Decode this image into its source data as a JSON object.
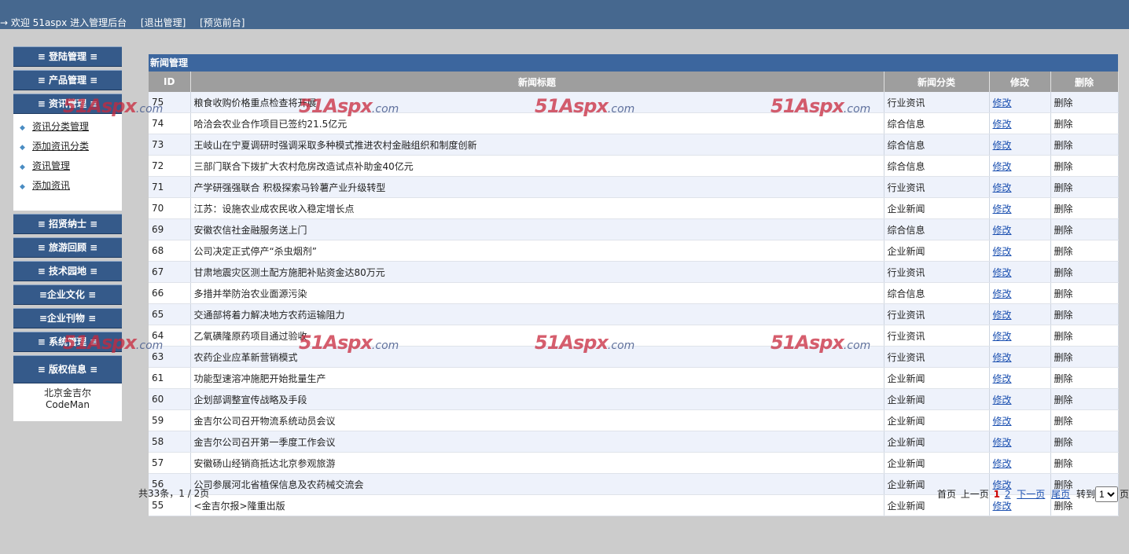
{
  "header": {
    "welcome": "→ 欢迎 51aspx  进入管理后台",
    "logout": "[退出管理]",
    "preview": "[预览前台]"
  },
  "sidebar": {
    "menus": [
      {
        "label": "≡ 登陆管理 ≡"
      },
      {
        "label": "≡ 产品管理 ≡"
      },
      {
        "label": "≡ 资讯管理 ≡"
      },
      {
        "label": "≡ 招贤纳士 ≡"
      },
      {
        "label": "≡ 旅游回顾 ≡"
      },
      {
        "label": "≡ 技术园地 ≡"
      },
      {
        "label": "≡企业文化 ≡"
      },
      {
        "label": "≡企业刊物 ≡"
      },
      {
        "label": "≡ 系统管理 ≡"
      },
      {
        "label": "≡ 版权信息 ≡"
      }
    ],
    "submenu": [
      {
        "label": "资讯分类管理"
      },
      {
        "label": "添加资讯分类"
      },
      {
        "label": "资讯管理"
      },
      {
        "label": "添加资讯"
      }
    ],
    "copyright_line1": "北京金吉尔",
    "copyright_line2": "CodeMan"
  },
  "panel": {
    "title": "新闻管理",
    "columns": [
      "ID",
      "新闻标题",
      "新闻分类",
      "修改",
      "删除"
    ],
    "rows": [
      {
        "id": "75",
        "title": "粮食收购价格重点检查将开展",
        "category": "行业资讯",
        "edit": "修改",
        "del": "删除"
      },
      {
        "id": "74",
        "title": "哈洽会农业合作项目已签约21.5亿元",
        "category": "综合信息",
        "edit": "修改",
        "del": "删除"
      },
      {
        "id": "73",
        "title": "王岐山在宁夏调研时强调采取多种模式推进农村金融组织和制度创新",
        "category": "综合信息",
        "edit": "修改",
        "del": "删除"
      },
      {
        "id": "72",
        "title": "三部门联合下拨扩大农村危房改造试点补助金40亿元",
        "category": "综合信息",
        "edit": "修改",
        "del": "删除"
      },
      {
        "id": "71",
        "title": "产学研强强联合 积极探索马铃薯产业升级转型",
        "category": "行业资讯",
        "edit": "修改",
        "del": "删除"
      },
      {
        "id": "70",
        "title": "江苏：设施农业成农民收入稳定增长点",
        "category": "企业新闻",
        "edit": "修改",
        "del": "删除"
      },
      {
        "id": "69",
        "title": "安徽农信社金融服务送上门",
        "category": "综合信息",
        "edit": "修改",
        "del": "删除"
      },
      {
        "id": "68",
        "title": "公司决定正式停产“杀虫烟剂”",
        "category": "企业新闻",
        "edit": "修改",
        "del": "删除"
      },
      {
        "id": "67",
        "title": "甘肃地震灾区测土配方施肥补贴资金达80万元",
        "category": "行业资讯",
        "edit": "修改",
        "del": "删除"
      },
      {
        "id": "66",
        "title": "多措并举防治农业面源污染",
        "category": "综合信息",
        "edit": "修改",
        "del": "删除"
      },
      {
        "id": "65",
        "title": "交通部将着力解决地方农药运输阻力",
        "category": "行业资讯",
        "edit": "修改",
        "del": "删除"
      },
      {
        "id": "64",
        "title": "乙氧磺隆原药项目通过验收",
        "category": "行业资讯",
        "edit": "修改",
        "del": "删除"
      },
      {
        "id": "63",
        "title": "农药企业应革新营销模式",
        "category": "行业资讯",
        "edit": "修改",
        "del": "删除"
      },
      {
        "id": "61",
        "title": "功能型速溶冲施肥开始批量生产",
        "category": "企业新闻",
        "edit": "修改",
        "del": "删除"
      },
      {
        "id": "60",
        "title": "企划部调整宣传战略及手段",
        "category": "企业新闻",
        "edit": "修改",
        "del": "删除"
      },
      {
        "id": "59",
        "title": "金吉尔公司召开物流系统动员会议",
        "category": "企业新闻",
        "edit": "修改",
        "del": "删除"
      },
      {
        "id": "58",
        "title": "金吉尔公司召开第一季度工作会议",
        "category": "企业新闻",
        "edit": "修改",
        "del": "删除"
      },
      {
        "id": "57",
        "title": "安徽砀山经销商抵达北京参观旅游",
        "category": "企业新闻",
        "edit": "修改",
        "del": "删除"
      },
      {
        "id": "56",
        "title": "公司参展河北省植保信息及农药械交流会",
        "category": "企业新闻",
        "edit": "修改",
        "del": "删除"
      },
      {
        "id": "55",
        "title": "<金吉尔报>隆重出版",
        "category": "企业新闻",
        "edit": "修改",
        "del": "删除"
      }
    ]
  },
  "footer": {
    "summary": "共33条，1 / 2页",
    "first": "首页",
    "prev": "上一页",
    "page1": "1",
    "page2": "2",
    "next": "下一页",
    "last": "尾页",
    "goto": "转到",
    "page_select": "1",
    "page_suffix": "页"
  },
  "watermark": {
    "main": "51Aspx",
    "suffix": ".com"
  }
}
